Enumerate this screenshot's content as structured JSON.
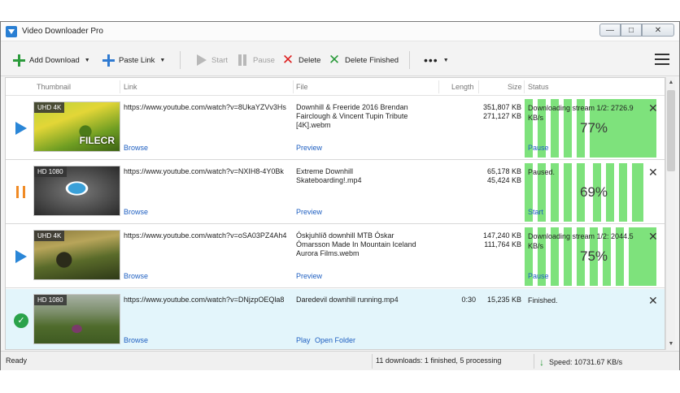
{
  "window": {
    "title": "Video Downloader Pro"
  },
  "toolbar": {
    "add_download": "Add Download",
    "paste_link": "Paste Link",
    "start": "Start",
    "pause": "Pause",
    "delete": "Delete",
    "delete_finished": "Delete Finished",
    "more": "•••"
  },
  "columns": {
    "thumbnail": "Thumbnail",
    "link": "Link",
    "file": "File",
    "length": "Length",
    "size": "Size",
    "status": "Status"
  },
  "rows": [
    {
      "state": "downloading",
      "badge": "UHD 4K",
      "watermark": "FILECR",
      "link": "https://www.youtube.com/watch?v=8UkaYZVv3Hs",
      "browse": "Browse",
      "file": "Downhill & Freeride 2016  Brendan Fairclough & Vincent Tupin Tribute [4K].webm",
      "preview": "Preview",
      "length": "",
      "size1": "351,807 KB",
      "size2": "271,127 KB",
      "status": "Downloading stream 1/2: 2726.9 KB/s",
      "percent_label": "77%",
      "percent": 77,
      "status_link": "Pause"
    },
    {
      "state": "paused",
      "badge": "HD 1080",
      "link": "https://www.youtube.com/watch?v=NXIH8-4Y0Bk",
      "browse": "Browse",
      "file": "Extreme Downhill Skateboarding!.mp4",
      "preview": "Preview",
      "length": "",
      "size1": "65,178 KB",
      "size2": "45,424 KB",
      "status": "Paused.",
      "percent_label": "69%",
      "percent": 69,
      "status_link": "Start"
    },
    {
      "state": "downloading",
      "badge": "UHD 4K",
      "link": "https://www.youtube.com/watch?v=oSA03PZ4Ah4",
      "browse": "Browse",
      "file": "Óskjuhlíð downhill MTB Óskar Ómarsson Made In Mountain  Iceland Aurora Films.webm",
      "preview": "Preview",
      "length": "",
      "size1": "147,240 KB",
      "size2": "111,764 KB",
      "status": "Downloading stream 1/2: 2044.5 KB/s",
      "percent_label": "75%",
      "percent": 75,
      "status_link": "Pause"
    },
    {
      "state": "finished",
      "badge": "HD 1080",
      "link": "https://www.youtube.com/watch?v=DNjzpOEQla8",
      "browse": "Browse",
      "file": "Daredevil downhill running.mp4",
      "preview": "Play",
      "open_folder": "Open Folder",
      "length": "0:30",
      "size1": "15,235 KB",
      "size2": "",
      "status": "Finished.",
      "status_link": ""
    }
  ],
  "statusbar": {
    "ready": "Ready",
    "count": "11 downloads: 1 finished, 5 processing",
    "speed": "Speed: 10731.67 KB/s"
  },
  "colors": {
    "progress": "#7ee27c",
    "link": "#1e5fc1",
    "selected_row": "#e3f5fb"
  }
}
